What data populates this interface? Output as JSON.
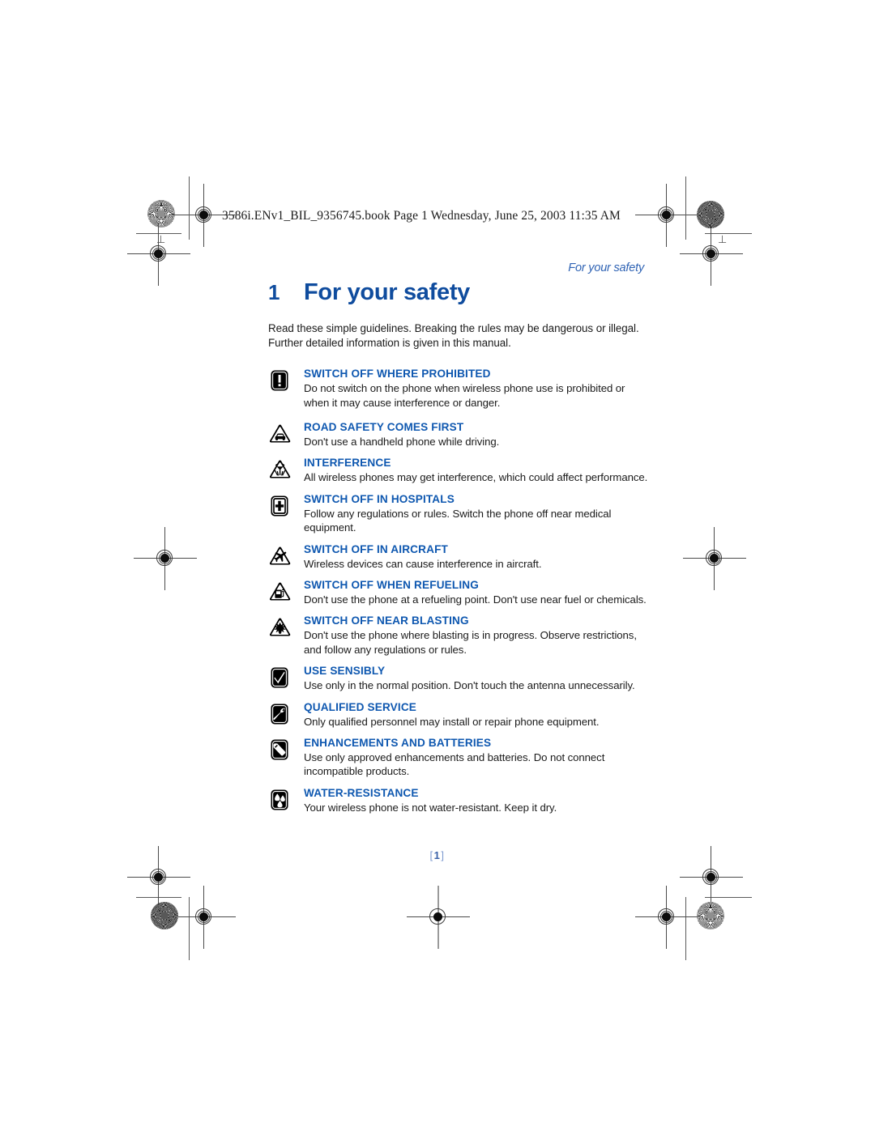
{
  "slug": "3586i.ENv1_BIL_9356745.book  Page 1  Wednesday, June 25, 2003  11:35 AM",
  "running_head": "For your safety",
  "chapter": {
    "number": "1",
    "title": "For your safety"
  },
  "intro": "Read these simple guidelines. Breaking the rules may be dangerous or illegal. Further detailed information is given in this manual.",
  "folio": {
    "open_bracket": "[",
    "page": "1",
    "close_bracket": "]"
  },
  "colors": {
    "heading_blue": "#0f4c9e",
    "item_blue": "#0f58b0",
    "runhead_blue": "#2f63b4",
    "folio_blue": "#3b62a8",
    "body_text": "#1a1a1a"
  },
  "items": [
    {
      "icon": "exclamation-square-icon",
      "title": "SWITCH OFF WHERE PROHIBITED",
      "text": "Do not switch on the phone when wireless phone use is prohibited or when it may cause interference or danger."
    },
    {
      "icon": "car-triangle-icon",
      "title": "ROAD SAFETY COMES FIRST",
      "text": "Don't use a handheld phone while driving."
    },
    {
      "icon": "interference-triangle-icon",
      "title": "INTERFERENCE",
      "text": "All wireless phones may get interference, which could affect performance."
    },
    {
      "icon": "hospital-cross-square-icon",
      "title": "SWITCH OFF IN HOSPITALS",
      "text": "Follow any regulations or rules. Switch the phone off near medical equipment."
    },
    {
      "icon": "aircraft-triangle-icon",
      "title": "SWITCH OFF IN AIRCRAFT",
      "text": "Wireless devices can cause interference in aircraft."
    },
    {
      "icon": "fuel-pump-triangle-icon",
      "title": "SWITCH OFF WHEN REFUELING",
      "text": "Don't use the phone at a refueling point. Don't use near fuel or chemicals."
    },
    {
      "icon": "blasting-triangle-icon",
      "title": "SWITCH OFF NEAR BLASTING",
      "text": "Don't use the phone where blasting is in progress. Observe restrictions, and follow any regulations or rules."
    },
    {
      "icon": "checkmark-square-icon",
      "title": "USE SENSIBLY",
      "text": "Use only in the normal position. Don't touch the antenna unnecessarily."
    },
    {
      "icon": "wrench-square-icon",
      "title": "QUALIFIED SERVICE",
      "text": "Only qualified personnel may install or repair phone equipment."
    },
    {
      "icon": "battery-square-icon",
      "title": "ENHANCEMENTS AND BATTERIES",
      "text": "Use only approved enhancements and batteries. Do not connect incompatible products."
    },
    {
      "icon": "water-drops-square-icon",
      "title": "WATER-RESISTANCE",
      "text": "Your wireless phone is not water-resistant. Keep it dry."
    }
  ]
}
